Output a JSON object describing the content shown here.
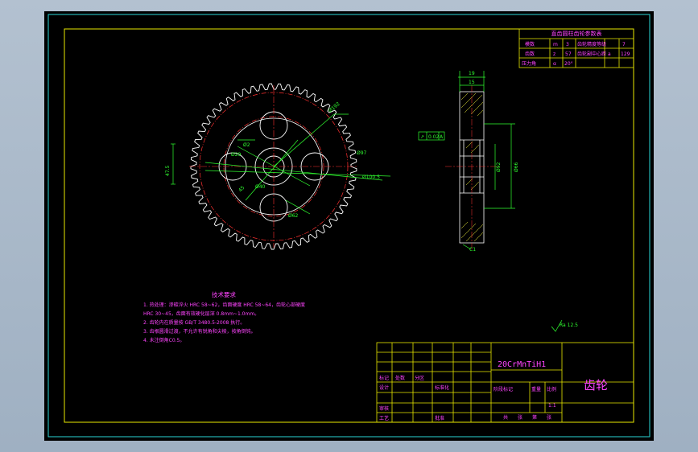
{
  "title_block": {
    "material": "20CrMnTiH1",
    "part_name": "齿轮",
    "row_labels": [
      "标记",
      "处数",
      "分区"
    ],
    "design": "设计",
    "standardize": "标准化",
    "check": "审核",
    "process": "工艺",
    "approve": "批准",
    "stage_mark": "阶段标记",
    "weight": "重量",
    "scale": "比例",
    "scale_value": "1:1",
    "sheets": [
      "共",
      "张",
      "第",
      "张"
    ]
  },
  "gear_table": {
    "title": "直齿圆柱齿轮参数表",
    "rows": [
      [
        "模数",
        "m",
        "3",
        "齿轮精度等级",
        "7"
      ],
      [
        "齿数",
        "z",
        "57",
        "齿轮副中心距",
        "a",
        "129"
      ],
      [
        "压力角",
        "α",
        "20°"
      ]
    ]
  },
  "tech_notes": {
    "title": "技术要求",
    "lines": [
      "1. 热处理：渗碳淬火 HRC 58~62，齿面硬度 HRC 58~64，齿轮心部硬度",
      "   HRC 30~45，齿面有效硬化层深 0.8mm~1.0mm。",
      "2. 齿轮内在质量按 GB/T 3480.5-2008 执行。",
      "3. 齿根圆滑过渡，不允许有锐角和尖棱，按角倒钝。",
      "4. 未注倒角C0.5。"
    ]
  },
  "dims": {
    "front": [
      "Ø192",
      "Ø97",
      "Ø100.5",
      "Ø62",
      "45",
      "Ø40",
      "47.5",
      "Ø2",
      "Ø29"
    ],
    "side": [
      "19",
      "15",
      "Ø92",
      "Ø66",
      "C1"
    ],
    "tolerance_frame": [
      "↗",
      "0.02",
      "A"
    ],
    "roughness": "Ra 12.5"
  }
}
